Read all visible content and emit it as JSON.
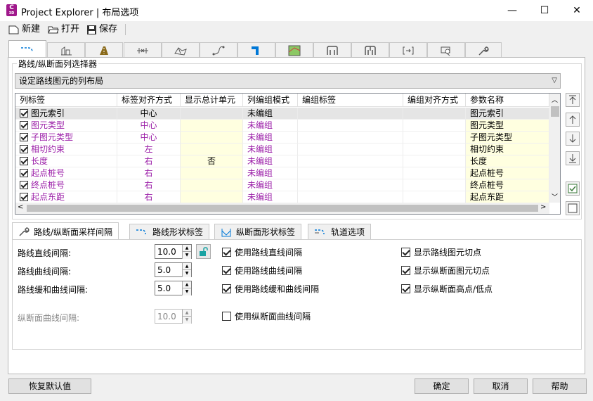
{
  "window": {
    "title": "Project Explorer | 布局选项",
    "icon_letter": "C",
    "icon_sub": "3D",
    "minimize": "—",
    "maximize": "☐",
    "close": "✕"
  },
  "toolbar": {
    "new_label": "新建",
    "open_label": "打开",
    "save_label": "保存"
  },
  "main_tabs": [
    "alignment-icon",
    "profile-icon",
    "corridor-icon",
    "assembly-icon",
    "surface-icon",
    "feature-line-icon",
    "pipe-icon",
    "parcel-icon",
    "structure-icon",
    "pressure-icon",
    "sample-icon",
    "point-icon",
    "wrench-icon"
  ],
  "selector": {
    "group_label": "路线/纵断面列选择器",
    "combo_value": "设定路线图元的列布局"
  },
  "grid": {
    "headers": [
      "列标签",
      "标签对齐方式",
      "显示总计单元",
      "列编组模式",
      "编组标签",
      "编组对齐方式",
      "参数名称"
    ],
    "rows": [
      {
        "checked": true,
        "label": "图元索引",
        "align": "中心",
        "total": "",
        "mode": "未编组",
        "group_label": "",
        "group_align": "",
        "param": "图元索引",
        "selected": true
      },
      {
        "checked": true,
        "label": "图元类型",
        "align": "中心",
        "total": "",
        "mode": "未编组",
        "group_label": "",
        "group_align": "",
        "param": "图元类型"
      },
      {
        "checked": true,
        "label": "子图元类型",
        "align": "中心",
        "total": "",
        "mode": "未编组",
        "group_label": "",
        "group_align": "",
        "param": "子图元类型"
      },
      {
        "checked": true,
        "label": "相切约束",
        "align": "左",
        "total": "",
        "mode": "未编组",
        "group_label": "",
        "group_align": "",
        "param": "相切约束"
      },
      {
        "checked": true,
        "label": "长度",
        "align": "右",
        "total": "否",
        "mode": "未编组",
        "group_label": "",
        "group_align": "",
        "param": "长度"
      },
      {
        "checked": true,
        "label": "起点桩号",
        "align": "右",
        "total": "",
        "mode": "未编组",
        "group_label": "",
        "group_align": "",
        "param": "起点桩号"
      },
      {
        "checked": true,
        "label": "终点桩号",
        "align": "右",
        "total": "",
        "mode": "未编组",
        "group_label": "",
        "group_align": "",
        "param": "终点桩号"
      },
      {
        "checked": true,
        "label": "起点东距",
        "align": "右",
        "total": "",
        "mode": "未编组",
        "group_label": "",
        "group_align": "",
        "param": "起点东距"
      }
    ]
  },
  "lower_tabs": [
    {
      "label": "路线/纵断面采样间隔",
      "icon": "wrench-icon"
    },
    {
      "label": "路线形状标签",
      "icon": "alignment-icon"
    },
    {
      "label": "纵断面形状标签",
      "icon": "profile-icon"
    },
    {
      "label": "轨道选项",
      "icon": "rail-icon"
    }
  ],
  "sampling": {
    "tangent_label": "路线直线间隔:",
    "tangent_value": "10.0",
    "curve_label": "路线曲线间隔:",
    "curve_value": "5.0",
    "spiral_label": "路线缓和曲线间隔:",
    "spiral_value": "5.0",
    "profile_curve_label": "纵断面曲线间隔:",
    "profile_curve_value": "10.0",
    "use_tangent": "使用路线直线间隔",
    "use_curve": "使用路线曲线间隔",
    "use_spiral": "使用路线缓和曲线间隔",
    "use_profile_curve": "使用纵断面曲线间隔",
    "show_alignment_tangent": "显示路线图元切点",
    "show_profile_tangent": "显示纵断面图元切点",
    "show_high_low": "显示纵断面高点/低点"
  },
  "footer": {
    "restore_label": "恢复默认值",
    "ok_label": "确定",
    "cancel_label": "取消",
    "help_label": "帮助"
  },
  "colors": {
    "accent": "#9b1ea8",
    "highlight": "#ffffe0",
    "link": "#0078d7"
  }
}
